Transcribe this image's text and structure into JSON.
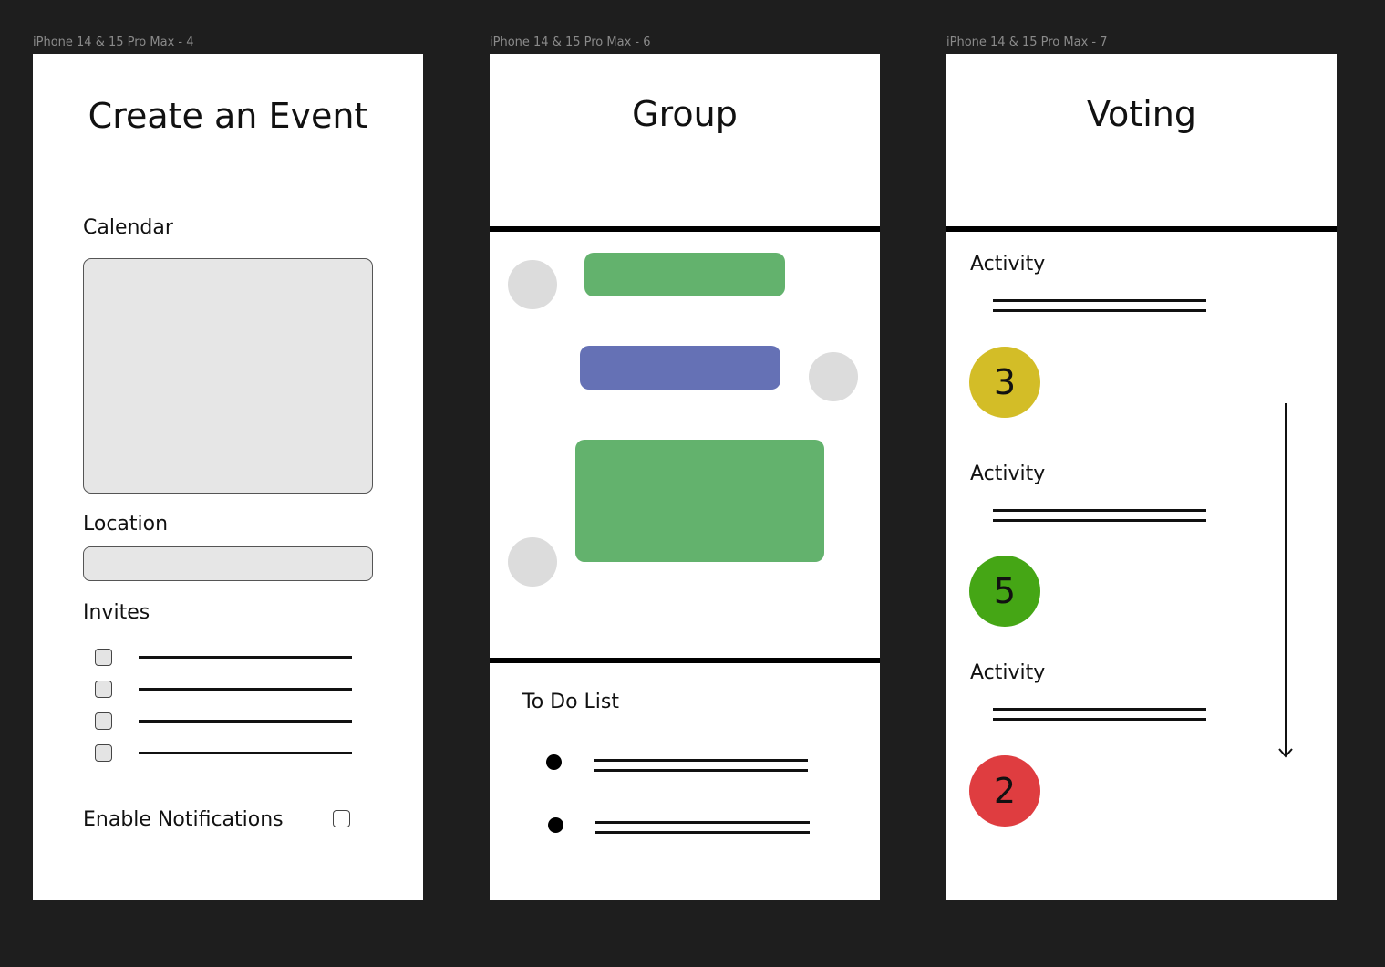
{
  "frames": [
    {
      "label": "iPhone 14 & 15 Pro Max - 4"
    },
    {
      "label": "iPhone 14 & 15 Pro Max - 6"
    },
    {
      "label": "iPhone 14 & 15 Pro Max - 7"
    }
  ],
  "create_event": {
    "title": "Create an Event",
    "calendar_label": "Calendar",
    "location_label": "Location",
    "invites_label": "Invites",
    "invite_count": 4,
    "notifications_label": "Enable Notifications"
  },
  "group": {
    "title": "Group",
    "colors": {
      "green": "#63b26d",
      "blue": "#6571b5",
      "avatar": "#dcdcdc"
    },
    "todo_title": "To Do List"
  },
  "voting": {
    "title": "Voting",
    "items": [
      {
        "label": "Activity",
        "votes": "3",
        "color": "#d3bd27"
      },
      {
        "label": "Activity",
        "votes": "5",
        "color": "#45a615"
      },
      {
        "label": "Activity",
        "votes": "2",
        "color": "#df3d40"
      }
    ]
  }
}
